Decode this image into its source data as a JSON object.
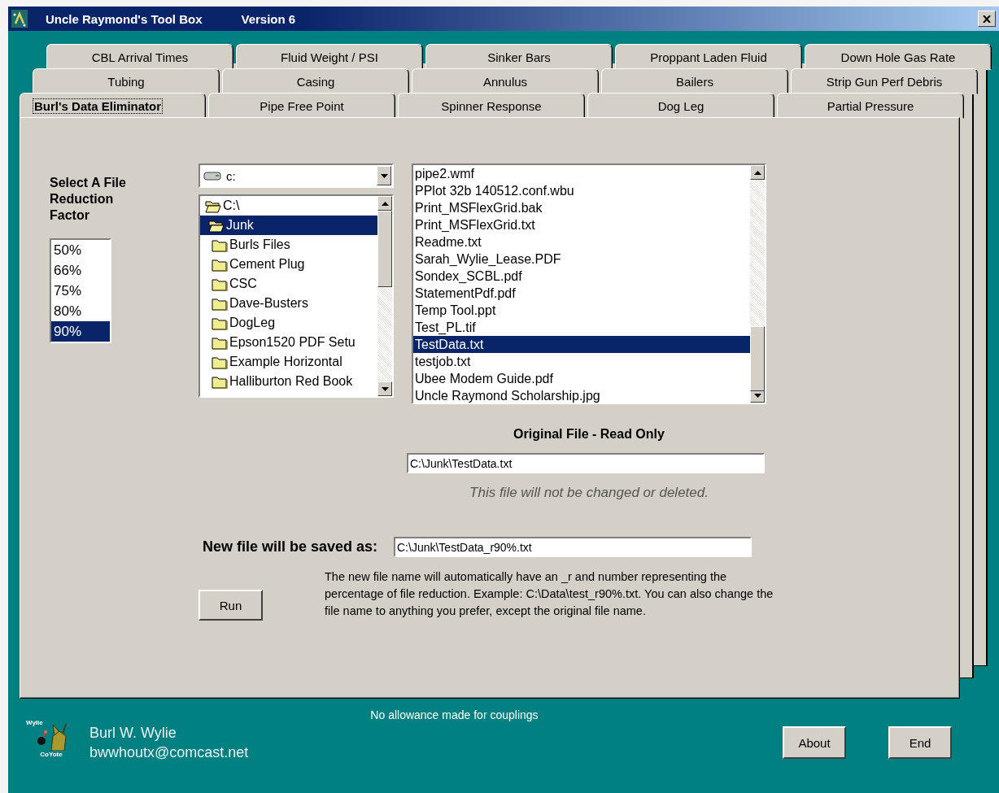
{
  "window": {
    "title": "Uncle Raymond's Tool Box",
    "version": "Version 6"
  },
  "tab_rows": [
    [
      {
        "label": "CBL Arrival Times",
        "selected": false
      },
      {
        "label": "Fluid Weight / PSI",
        "selected": false
      },
      {
        "label": "Sinker Bars",
        "selected": false
      },
      {
        "label": "Proppant Laden Fluid",
        "selected": false
      },
      {
        "label": "Down Hole Gas Rate",
        "selected": false
      }
    ],
    [
      {
        "label": "Tubing",
        "selected": false
      },
      {
        "label": "Casing",
        "selected": false
      },
      {
        "label": "Annulus",
        "selected": false
      },
      {
        "label": "Bailers",
        "selected": false
      },
      {
        "label": "Strip Gun Perf Debris",
        "selected": false
      }
    ],
    [
      {
        "label": "Burl's Data Eliminator",
        "selected": true
      },
      {
        "label": "Pipe Free Point",
        "selected": false
      },
      {
        "label": "Spinner Response",
        "selected": false
      },
      {
        "label": "Dog Leg",
        "selected": false
      },
      {
        "label": "Partial Pressure",
        "selected": false
      }
    ]
  ],
  "reduction": {
    "label": "Select A File Reduction Factor",
    "options": [
      {
        "label": "50%",
        "selected": false
      },
      {
        "label": "66%",
        "selected": false
      },
      {
        "label": "75%",
        "selected": false
      },
      {
        "label": "80%",
        "selected": false
      },
      {
        "label": "90%",
        "selected": true
      }
    ]
  },
  "drive": {
    "value": "c:"
  },
  "folders": [
    {
      "name": "C:\\",
      "kind": "open",
      "selected": false,
      "children": [
        {
          "name": "Junk",
          "kind": "open",
          "selected": true,
          "children": [
            {
              "name": "Burls Files",
              "kind": "closed",
              "selected": false
            },
            {
              "name": "Cement Plug",
              "kind": "closed",
              "selected": false
            },
            {
              "name": "CSC",
              "kind": "closed",
              "selected": false
            },
            {
              "name": "Dave-Busters",
              "kind": "closed",
              "selected": false
            },
            {
              "name": "DogLeg",
              "kind": "closed",
              "selected": false
            },
            {
              "name": "Epson1520 PDF Setu",
              "kind": "closed",
              "selected": false
            },
            {
              "name": "Example Horizontal",
              "kind": "closed",
              "selected": false
            },
            {
              "name": "Halliburton Red Book",
              "kind": "closed",
              "selected": false
            }
          ]
        }
      ]
    }
  ],
  "files": [
    {
      "name": "pipe2.wmf",
      "selected": false
    },
    {
      "name": "PPlot 32b 140512.conf.wbu",
      "selected": false
    },
    {
      "name": "Print_MSFlexGrid.bak",
      "selected": false
    },
    {
      "name": "Print_MSFlexGrid.txt",
      "selected": false
    },
    {
      "name": "Readme.txt",
      "selected": false
    },
    {
      "name": "Sarah_Wylie_Lease.PDF",
      "selected": false
    },
    {
      "name": "Sondex_SCBL.pdf",
      "selected": false
    },
    {
      "name": "StatementPdf.pdf",
      "selected": false
    },
    {
      "name": "Temp Tool.ppt",
      "selected": false
    },
    {
      "name": "Test_PL.tif",
      "selected": false
    },
    {
      "name": "TestData.txt",
      "selected": true
    },
    {
      "name": "testjob.txt",
      "selected": false
    },
    {
      "name": "Ubee Modem Guide.pdf",
      "selected": false
    },
    {
      "name": "Uncle Raymond Scholarship.jpg",
      "selected": false
    }
  ],
  "original_file": {
    "heading": "Original File - Read Only",
    "value": "C:\\Junk\\TestData.txt",
    "note": "This file will not be changed or deleted."
  },
  "new_file": {
    "label": "New file will be saved as:",
    "value": "C:\\Junk\\TestData_r90%.txt"
  },
  "run_button": "Run",
  "help_text": "The new file name will automatically have an _r and number representing the percentage of file reduction.  Example: C:\\Data\\test_r90%.txt. You can also change the file name to anything you prefer, except the original file name.",
  "footer": {
    "logo_texts": [
      "Wylie",
      "CoYote"
    ],
    "author": "Burl W. Wylie",
    "email": "bwwhoutx@comcast.net",
    "note": "No allowance made for couplings",
    "buttons": [
      "About",
      "End"
    ]
  }
}
